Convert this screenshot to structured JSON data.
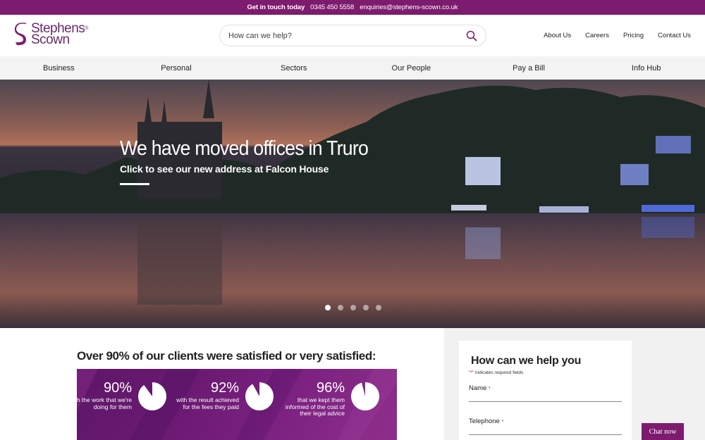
{
  "topbar": {
    "cta": "Get in touch today",
    "phone": "0345 450 5558",
    "email": "enquiries@stephens-scown.co.uk"
  },
  "brand": {
    "line1": "Stephens",
    "line2": "Scown",
    "color": "#7d1b6e"
  },
  "search": {
    "placeholder": "How can we help?",
    "icon": "search-icon"
  },
  "utility_nav": [
    "About Us",
    "Careers",
    "Pricing",
    "Contact Us"
  ],
  "main_nav": [
    "Business",
    "Personal",
    "Sectors",
    "Our People",
    "Pay a Bill",
    "Info Hub"
  ],
  "hero": {
    "title": "We have moved offices in Truro",
    "subtitle": "Click to see our new address at Falcon House",
    "slides": 5,
    "active_slide": 1
  },
  "stats": {
    "heading": "Over 90% of our clients were satisfied or very satisfied:",
    "items": [
      {
        "value": "90%",
        "label": "with the work that we're doing for them",
        "fraction": 0.9
      },
      {
        "value": "92%",
        "label": "with the result achieved for the fees they paid",
        "fraction": 0.92
      },
      {
        "value": "96%",
        "label": "that we kept them informed of the cost of their legal advice",
        "fraction": 0.96
      }
    ]
  },
  "form": {
    "title": "How can we help you",
    "required_marker": "\"*\"",
    "required_note": " indicates required fields",
    "fields": [
      {
        "label": "Name",
        "required": "*"
      },
      {
        "label": "Telephone",
        "required": "*"
      }
    ]
  },
  "chat": {
    "label": "Chat now"
  }
}
